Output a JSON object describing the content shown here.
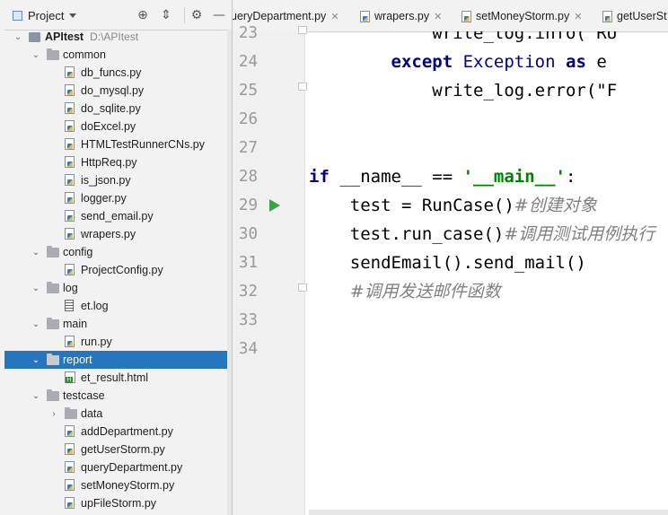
{
  "project_panel": {
    "title": "Project",
    "toolbar_icons": [
      "crosshair-icon",
      "collapse-icon",
      "gear-icon",
      "minimize-icon"
    ],
    "tree": [
      {
        "label": "APItest",
        "path": "D:\\APItest",
        "type": "project",
        "expanded": true
      },
      {
        "label": "common",
        "type": "folder",
        "expanded": true
      },
      {
        "label": "db_funcs.py",
        "type": "py"
      },
      {
        "label": "do_mysql.py",
        "type": "py"
      },
      {
        "label": "do_sqlite.py",
        "type": "py"
      },
      {
        "label": "doExcel.py",
        "type": "py"
      },
      {
        "label": "HTMLTestRunnerCNs.py",
        "type": "py"
      },
      {
        "label": "HttpReq.py",
        "type": "py"
      },
      {
        "label": "is_json.py",
        "type": "py"
      },
      {
        "label": "logger.py",
        "type": "py"
      },
      {
        "label": "send_email.py",
        "type": "py"
      },
      {
        "label": "wrapers.py",
        "type": "py"
      },
      {
        "label": "config",
        "type": "folder",
        "expanded": true
      },
      {
        "label": "ProjectConfig.py",
        "type": "py"
      },
      {
        "label": "log",
        "type": "folder",
        "expanded": true
      },
      {
        "label": "et.log",
        "type": "log"
      },
      {
        "label": "main",
        "type": "folder",
        "expanded": true
      },
      {
        "label": "run.py",
        "type": "py"
      },
      {
        "label": "report",
        "type": "folder",
        "expanded": true,
        "selected": true
      },
      {
        "label": "et_result.html",
        "type": "html"
      },
      {
        "label": "testcase",
        "type": "folder",
        "expanded": true
      },
      {
        "label": "data",
        "type": "folder",
        "expanded": false
      },
      {
        "label": "addDepartment.py",
        "type": "py"
      },
      {
        "label": "getUserStorm.py",
        "type": "py"
      },
      {
        "label": "queryDepartment.py",
        "type": "py"
      },
      {
        "label": "setMoneyStorm.py",
        "type": "py"
      },
      {
        "label": "upFileStorm.py",
        "type": "py"
      }
    ]
  },
  "editor_tabs": [
    {
      "label": "ueryDepartment.py"
    },
    {
      "label": "wrapers.py"
    },
    {
      "label": "setMoneyStorm.py"
    },
    {
      "label": "getUserSt"
    }
  ],
  "line_numbers": [
    "23",
    "24",
    "25",
    "26",
    "27",
    "28",
    "29",
    "30",
    "31",
    "32",
    "33",
    "34"
  ],
  "code_lines": [
    [
      {
        "t": "            write_log.info(\"RU",
        "c": ""
      }
    ],
    [
      {
        "t": "        ",
        "c": ""
      },
      {
        "t": "except",
        "c": "kw"
      },
      {
        "t": " ",
        "c": ""
      },
      {
        "t": "Exception",
        "c": "cls"
      },
      {
        "t": " ",
        "c": ""
      },
      {
        "t": "as",
        "c": "kw"
      },
      {
        "t": " e",
        "c": ""
      }
    ],
    [
      {
        "t": "            write_log.error(\"F",
        "c": ""
      }
    ],
    [],
    [],
    [
      {
        "t": "if",
        "c": "kw"
      },
      {
        "t": " __name__ == ",
        "c": ""
      },
      {
        "t": "'__main__'",
        "c": "str"
      },
      {
        "t": ":",
        "c": ""
      }
    ],
    [
      {
        "t": "    test = RunCase()",
        "c": ""
      },
      {
        "t": "#创建对象",
        "c": "cmt"
      }
    ],
    [
      {
        "t": "    test.run_case()",
        "c": ""
      },
      {
        "t": "#调用测试用例执行",
        "c": "cmt"
      }
    ],
    [
      {
        "t": "    sendEmail().send_mail()",
        "c": ""
      }
    ],
    [
      {
        "t": "    ",
        "c": ""
      },
      {
        "t": "#调用发送邮件函数",
        "c": "cmt"
      }
    ],
    [],
    []
  ]
}
